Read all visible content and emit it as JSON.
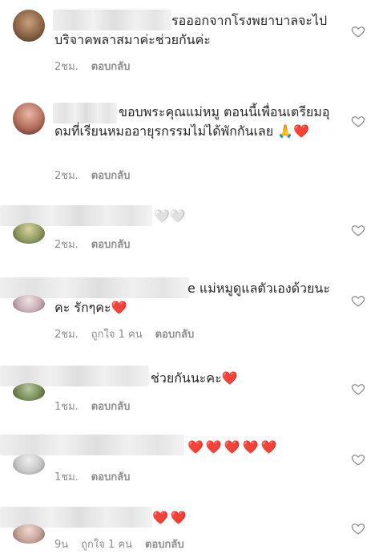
{
  "comments": [
    {
      "text": "รอออกจากโรงพยาบาลจะไปบริจาคพลาสมาค่ะช่วยกันค่ะ",
      "time": "2ชม.",
      "likes": "",
      "reply": "ตอบกลับ"
    },
    {
      "text": "ขอบพระคุณแม่หมู ตอนนี้เพื่อนเตรียมอุดมที่เรียนหมออายุรกรรมไม่ได้พักกันเลย",
      "emoji": "🙏❤️",
      "time": "2ชม.",
      "likes": "",
      "reply": "ตอบกลับ"
    },
    {
      "text": "",
      "emoji": "🤍🤍",
      "time": "2ชม.",
      "likes": "",
      "reply": "ตอบกลับ"
    },
    {
      "text": "e แม่หมูดูแลตัวเองด้วยนะคะ รักๆคะ",
      "emoji": "❤️",
      "time": "2ชม.",
      "likes": "ถูกใจ 1 คน",
      "reply": "ตอบกลับ"
    },
    {
      "text": "ช่วยกันนะคะ",
      "emoji": "❤️",
      "time": "1ชม.",
      "likes": "",
      "reply": "ตอบกลับ"
    },
    {
      "text": "",
      "emoji": "❤️❤️❤️❤️❤️",
      "time": "1ชม.",
      "likes": "",
      "reply": "ตอบกลับ"
    },
    {
      "text": "",
      "emoji": "❤️❤️",
      "time": "9น",
      "likes": "ถูกใจ 1 คน",
      "reply": "ตอบกลับ"
    }
  ],
  "icons": {
    "like": "heart-outline-icon"
  },
  "colors": {
    "text": "#262626",
    "meta": "#8e8e8e",
    "heart": "#e0202b"
  }
}
